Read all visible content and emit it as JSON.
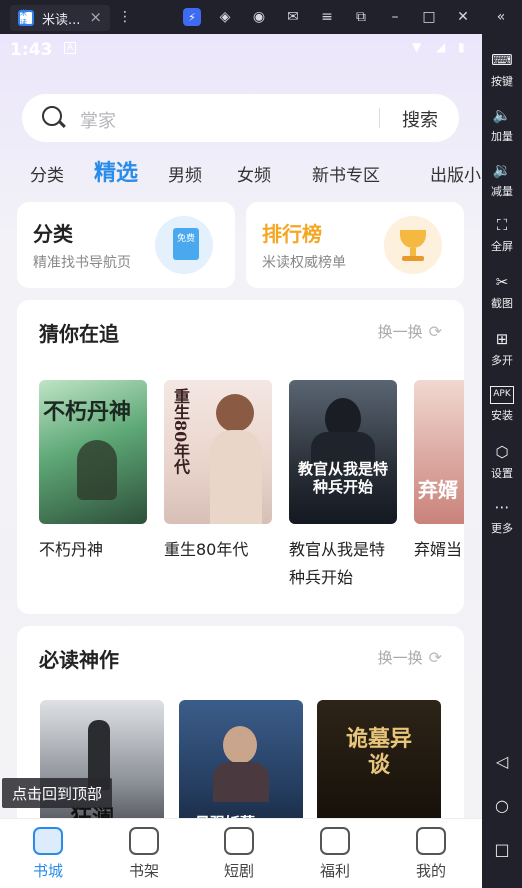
{
  "window": {
    "app_tab_title": "米读...",
    "app_icon_text": "米读"
  },
  "sidebar": {
    "items": [
      {
        "label": "按键",
        "icon": "keyboard-icon"
      },
      {
        "label": "加量",
        "icon": "volume-up-icon"
      },
      {
        "label": "减量",
        "icon": "volume-down-icon"
      },
      {
        "label": "全屏",
        "icon": "fullscreen-icon"
      },
      {
        "label": "截图",
        "icon": "scissors-icon"
      },
      {
        "label": "多开",
        "icon": "multi-instance-icon"
      },
      {
        "label": "安装",
        "icon": "apk-icon"
      },
      {
        "label": "设置",
        "icon": "settings-icon"
      },
      {
        "label": "更多",
        "icon": "more-icon"
      }
    ]
  },
  "status_bar": {
    "time": "1:43"
  },
  "search": {
    "placeholder": "搜索",
    "placeholder_text": "掌家",
    "button": "搜索"
  },
  "tabs": [
    "分类",
    "精选",
    "男频",
    "女频",
    "新书专区",
    "出版小"
  ],
  "active_tab": "精选",
  "quick_cards": [
    {
      "title": "分类",
      "subtitle": "精准找书导航页",
      "badge_text": "免费",
      "accent": "#4aa8ef"
    },
    {
      "title": "排行榜",
      "subtitle": "米读权威榜单",
      "accent": "#f5a623"
    }
  ],
  "section_following": {
    "title": "猜你在追",
    "swap_label": "换一换",
    "books": [
      {
        "title": "不朽丹神",
        "cover_text": "不朽丹神"
      },
      {
        "title": "重生80年代",
        "cover_text": "重生80年代"
      },
      {
        "title": "教官从我是特种兵开始",
        "title_line1": "教官从我是特",
        "title_line2": "种兵开始",
        "cover_text": "教官从我是特种兵开始"
      },
      {
        "title": "弃婿当",
        "cover_text": "弃婿"
      }
    ]
  },
  "section_must_read": {
    "title": "必读神作",
    "swap_label": "换一换",
    "books": [
      {
        "cover_text": "狂澜"
      },
      {
        "cover_text": "最强妖孽"
      },
      {
        "cover_text": "诡墓异谈"
      }
    ]
  },
  "toast": "点击回到顶部",
  "bottom_nav": [
    {
      "label": "书城",
      "active": true
    },
    {
      "label": "书架"
    },
    {
      "label": "短剧"
    },
    {
      "label": "福利"
    },
    {
      "label": "我的"
    }
  ],
  "colors": {
    "accent": "#2a8ce8",
    "rank_orange": "#f5a623"
  }
}
